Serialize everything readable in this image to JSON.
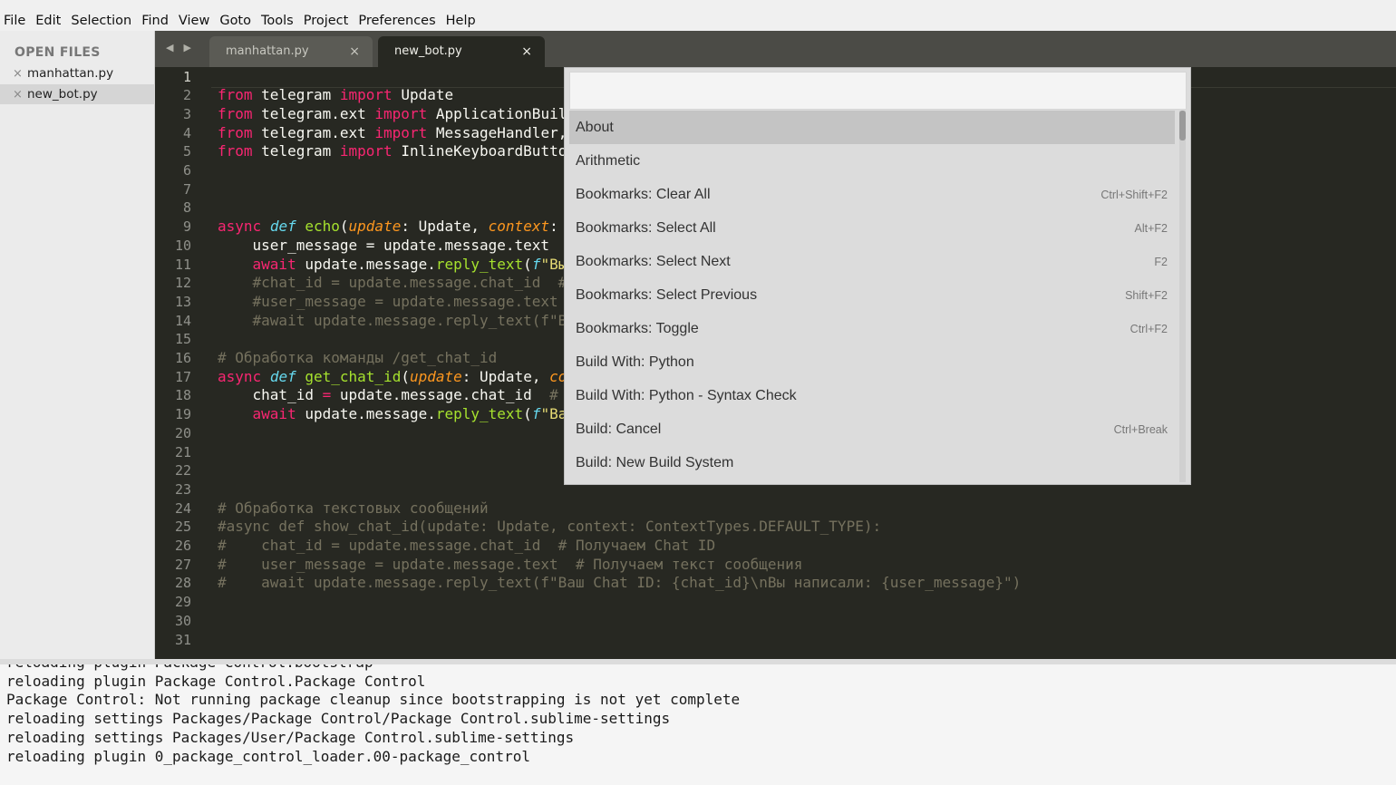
{
  "menu": [
    "File",
    "Edit",
    "Selection",
    "Find",
    "View",
    "Goto",
    "Tools",
    "Project",
    "Preferences",
    "Help"
  ],
  "sidebar": {
    "header": "OPEN FILES",
    "files": [
      {
        "name": "manhattan.py",
        "close": "×"
      },
      {
        "name": "new_bot.py",
        "close": "×"
      }
    ]
  },
  "tabs": [
    {
      "title": "manhattan.py",
      "close": "×"
    },
    {
      "title": "new_bot.py",
      "close": "×"
    }
  ],
  "nav_arrows": "◀ ▶",
  "editor": {
    "line_numbers": [
      "1",
      "2",
      "3",
      "4",
      "5",
      "6",
      "7",
      "8",
      "9",
      "10",
      "11",
      "12",
      "13",
      "14",
      "15",
      "16",
      "17",
      "18",
      "19",
      "20",
      "21",
      "22",
      "23",
      "24",
      "25",
      "26",
      "27",
      "28",
      "29",
      "30",
      "31"
    ],
    "lines": {
      "l3_mod": "telegram",
      "l3_imp": "Update",
      "l4_mod": "telegram.ext",
      "l4_imp": "ApplicationBuil",
      "l5_mod": "telegram.ext",
      "l5_imp": "MessageHandler,",
      "l6_mod": "telegram",
      "l6_imp": "InlineKeyboardButto",
      "l10_fn": "echo",
      "l10_p1": "update",
      "l10_t1": "Update",
      "l10_p2": "context",
      "l11": "user_message = update.message.text",
      "l12_obj": "update.message.",
      "l12_call": "reply_text",
      "l12_str": "\"Вы",
      "l13": "#chat_id = update.message.chat_id  #",
      "l14": "#user_message = update.message.text",
      "l15": "#await update.message.reply_text(f\"Ва",
      "l17": "# Обработка команды /get_chat_id",
      "l18_fn": "get_chat_id",
      "l18_p1": "update",
      "l18_t1": "Update",
      "l18_p2": "co",
      "l19_a": "chat_id",
      "l19_b": "update.message.chat_id",
      "l19_c": "# l",
      "l20_obj": "update.message.",
      "l20_call": "reply_text",
      "l20_str": "\"Ва",
      "l25": "# Обработка текстовых сообщений",
      "l26": "#async def show_chat_id(update: Update, context: ContextTypes.DEFAULT_TYPE):",
      "l27": "#    chat_id = update.message.chat_id  # Получаем Chat ID",
      "l28": "#    user_message = update.message.text  # Получаем текст сообщения",
      "l29": "#    await update.message.reply_text(f\"Ваш Chat ID: {chat_id}\\nВы написали: {user_message}\")"
    },
    "kw": {
      "from": "from",
      "import": "import",
      "async": "async",
      "def": "def",
      "await": "await",
      "f": "f",
      "eq": "="
    }
  },
  "palette": {
    "query": "",
    "items": [
      {
        "label": "About",
        "shortcut": ""
      },
      {
        "label": "Arithmetic",
        "shortcut": ""
      },
      {
        "label": "Bookmarks: Clear All",
        "shortcut": "Ctrl+Shift+F2"
      },
      {
        "label": "Bookmarks: Select All",
        "shortcut": "Alt+F2"
      },
      {
        "label": "Bookmarks: Select Next",
        "shortcut": "F2"
      },
      {
        "label": "Bookmarks: Select Previous",
        "shortcut": "Shift+F2"
      },
      {
        "label": "Bookmarks: Toggle",
        "shortcut": "Ctrl+F2"
      },
      {
        "label": "Build With: Python",
        "shortcut": ""
      },
      {
        "label": "Build With: Python - Syntax Check",
        "shortcut": ""
      },
      {
        "label": "Build: Cancel",
        "shortcut": "Ctrl+Break"
      },
      {
        "label": "Build: New Build System",
        "shortcut": ""
      }
    ]
  },
  "console": {
    "lines": [
      "reloading plugin Package Control.bootstrap",
      "reloading plugin Package Control.Package Control",
      "Package Control: Not running package cleanup since bootstrapping is not yet complete",
      "reloading settings Packages/Package Control/Package Control.sublime-settings",
      "reloading settings Packages/User/Package Control.sublime-settings",
      "reloading plugin 0_package_control_loader.00-package_control"
    ]
  },
  "colors": {
    "editor_bg": "#272822",
    "keyword": "#f92672",
    "function": "#a6e22e",
    "param": "#fd971f",
    "string": "#e6db74",
    "comment": "#75715e",
    "storage": "#66d9ef"
  }
}
